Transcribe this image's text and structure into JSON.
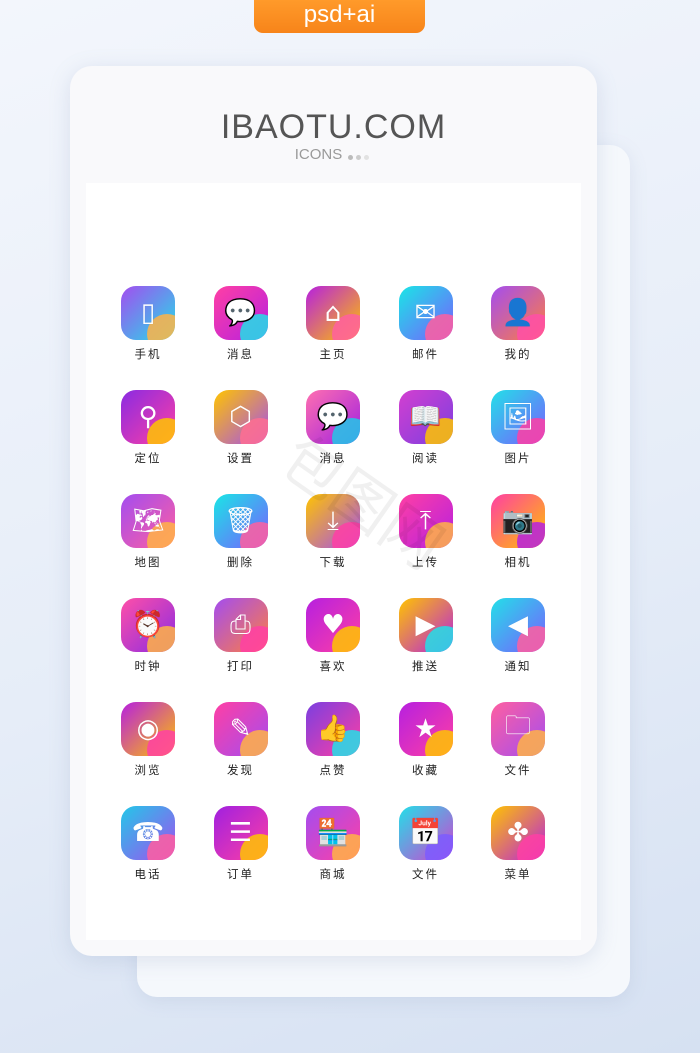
{
  "badge": "psd+ai",
  "brand": "IBAOTU.COM",
  "subtitle": "ICONS",
  "watermark": "包图网",
  "icons": [
    {
      "label": "手机",
      "icon": "phone-icon",
      "glyph": "▯",
      "c1": "#a34df0",
      "c2": "#22e0e8",
      "c3": "#ffb347"
    },
    {
      "label": "消息",
      "icon": "chat-bubble-icon",
      "glyph": "💬",
      "c1": "#ff3fa4",
      "c2": "#b620e0",
      "c3": "#22e0e8"
    },
    {
      "label": "主页",
      "icon": "home-icon",
      "glyph": "⌂",
      "c1": "#b620e0",
      "c2": "#ffc400",
      "c3": "#ff5fa0"
    },
    {
      "label": "邮件",
      "icon": "mail-icon",
      "glyph": "✉",
      "c1": "#19e6e6",
      "c2": "#7b5cff",
      "c3": "#ff5fa0"
    },
    {
      "label": "我的",
      "icon": "user-icon",
      "glyph": "👤",
      "c1": "#a34df0",
      "c2": "#ff7e3f",
      "c3": "#ff4fa8"
    },
    {
      "label": "定位",
      "icon": "location-pin-icon",
      "glyph": "⚲",
      "c1": "#8a2be2",
      "c2": "#ff3fa4",
      "c3": "#ffc400"
    },
    {
      "label": "设置",
      "icon": "settings-hexagon-icon",
      "glyph": "⬡",
      "c1": "#ffc400",
      "c2": "#a34df0",
      "c3": "#ff6f91"
    },
    {
      "label": "消息",
      "icon": "chat-bubble-icon",
      "glyph": "💬",
      "c1": "#ff6fb0",
      "c2": "#a020e0",
      "c3": "#22c8e8"
    },
    {
      "label": "阅读",
      "icon": "book-icon",
      "glyph": "📖",
      "c1": "#d33fd0",
      "c2": "#7b3fe0",
      "c3": "#ffc400"
    },
    {
      "label": "图片",
      "icon": "image-icon",
      "glyph": "🖼",
      "c1": "#22e0e8",
      "c2": "#7b5cff",
      "c3": "#ff3fa4"
    },
    {
      "label": "地图",
      "icon": "map-icon",
      "glyph": "🗺",
      "c1": "#a34df0",
      "c2": "#ff5fa0",
      "c3": "#ffb347"
    },
    {
      "label": "删除",
      "icon": "trash-icon",
      "glyph": "🗑",
      "c1": "#19e6e6",
      "c2": "#7b5cff",
      "c3": "#ff5fa0"
    },
    {
      "label": "下载",
      "icon": "download-icon",
      "glyph": "⤓",
      "c1": "#ffc400",
      "c2": "#a34df0",
      "c3": "#ff3fa4"
    },
    {
      "label": "上传",
      "icon": "upload-icon",
      "glyph": "⤒",
      "c1": "#ff3fa4",
      "c2": "#b620e0",
      "c3": "#ffb347"
    },
    {
      "label": "相机",
      "icon": "camera-icon",
      "glyph": "📷",
      "c1": "#ff3fa4",
      "c2": "#ffc400",
      "c3": "#b620e0"
    },
    {
      "label": "时钟",
      "icon": "alarm-clock-icon",
      "glyph": "⏰",
      "c1": "#ff4fa8",
      "c2": "#8a2be2",
      "c3": "#ffb347"
    },
    {
      "label": "打印",
      "icon": "printer-icon",
      "glyph": "⎙",
      "c1": "#a34df0",
      "c2": "#ff7e3f",
      "c3": "#ff3fa4"
    },
    {
      "label": "喜欢",
      "icon": "heart-icon",
      "glyph": "♥",
      "c1": "#b620e0",
      "c2": "#ff3fa4",
      "c3": "#ffc400"
    },
    {
      "label": "推送",
      "icon": "play-push-icon",
      "glyph": "▶",
      "c1": "#ffc400",
      "c2": "#b620e0",
      "c3": "#22e0e8"
    },
    {
      "label": "通知",
      "icon": "speaker-icon",
      "glyph": "◀",
      "c1": "#22e0e8",
      "c2": "#7b5cff",
      "c3": "#ff5fa0"
    },
    {
      "label": "浏览",
      "icon": "eye-icon",
      "glyph": "◉",
      "c1": "#b620e0",
      "c2": "#ffc400",
      "c3": "#ff3fa4"
    },
    {
      "label": "发现",
      "icon": "compass-icon",
      "glyph": "✎",
      "c1": "#ff3fa4",
      "c2": "#a34df0",
      "c3": "#ffb347"
    },
    {
      "label": "点赞",
      "icon": "thumbs-up-icon",
      "glyph": "👍",
      "c1": "#7b3fe0",
      "c2": "#ff3fa4",
      "c3": "#22e0e8"
    },
    {
      "label": "收藏",
      "icon": "star-icon",
      "glyph": "★",
      "c1": "#b620e0",
      "c2": "#ff3fa4",
      "c3": "#ffc400"
    },
    {
      "label": "文件",
      "icon": "folder-icon",
      "glyph": "🗀",
      "c1": "#ff5fa0",
      "c2": "#a34df0",
      "c3": "#ffb347"
    },
    {
      "label": "电话",
      "icon": "telephone-icon",
      "glyph": "☎",
      "c1": "#22c8e8",
      "c2": "#a34df0",
      "c3": "#ff5fa0"
    },
    {
      "label": "订单",
      "icon": "order-list-icon",
      "glyph": "☰",
      "c1": "#a020e0",
      "c2": "#ff3fa4",
      "c3": "#ffc400"
    },
    {
      "label": "商城",
      "icon": "shop-icon",
      "glyph": "🏪",
      "c1": "#a34df0",
      "c2": "#ff3fa4",
      "c3": "#ffb347"
    },
    {
      "label": "文件",
      "icon": "calendar-file-icon",
      "glyph": "📅",
      "c1": "#22e0e8",
      "c2": "#d33fd0",
      "c3": "#7b5cff"
    },
    {
      "label": "菜单",
      "icon": "menu-clover-icon",
      "glyph": "✤",
      "c1": "#ffc400",
      "c2": "#b620e0",
      "c3": "#ff3fa4"
    }
  ]
}
